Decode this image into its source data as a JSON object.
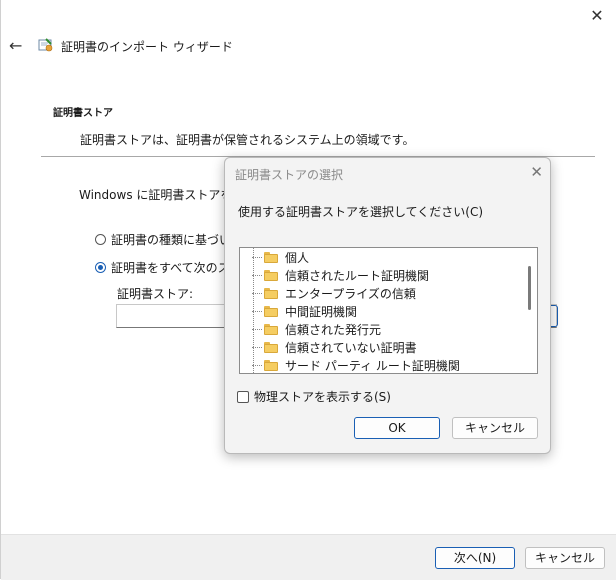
{
  "wizard": {
    "title": "証明書のインポート ウィザード",
    "heading": "証明書ストア",
    "description": "証明書ストアは、証明書が保管されるシステム上の領域です。",
    "body_text": "Windows に証明書ストアを自",
    "radio_auto": "証明書の種類に基づい",
    "radio_manual": "証明書をすべて次のスト",
    "store_label": "証明書ストア:",
    "store_value": "",
    "next_label": "次へ(N)",
    "cancel_label": "キャンセル",
    "close_glyph": "✕",
    "back_glyph": "←"
  },
  "dialog": {
    "title": "証明書ストアの選択",
    "close_glyph": "✕",
    "prompt": "使用する証明書ストアを選択してください(C)",
    "items": [
      "個人",
      "信頼されたルート証明機関",
      "エンタープライズの信頼",
      "中間証明機関",
      "信頼された発行元",
      "信頼されていない証明書",
      "サード パーティ ルート証明機関"
    ],
    "physical_store_label": "物理ストアを表示する(S)",
    "ok_label": "OK",
    "cancel_label": "キャンセル"
  },
  "colors": {
    "accent": "#1a5fb4",
    "folder": "#f5cd62"
  }
}
